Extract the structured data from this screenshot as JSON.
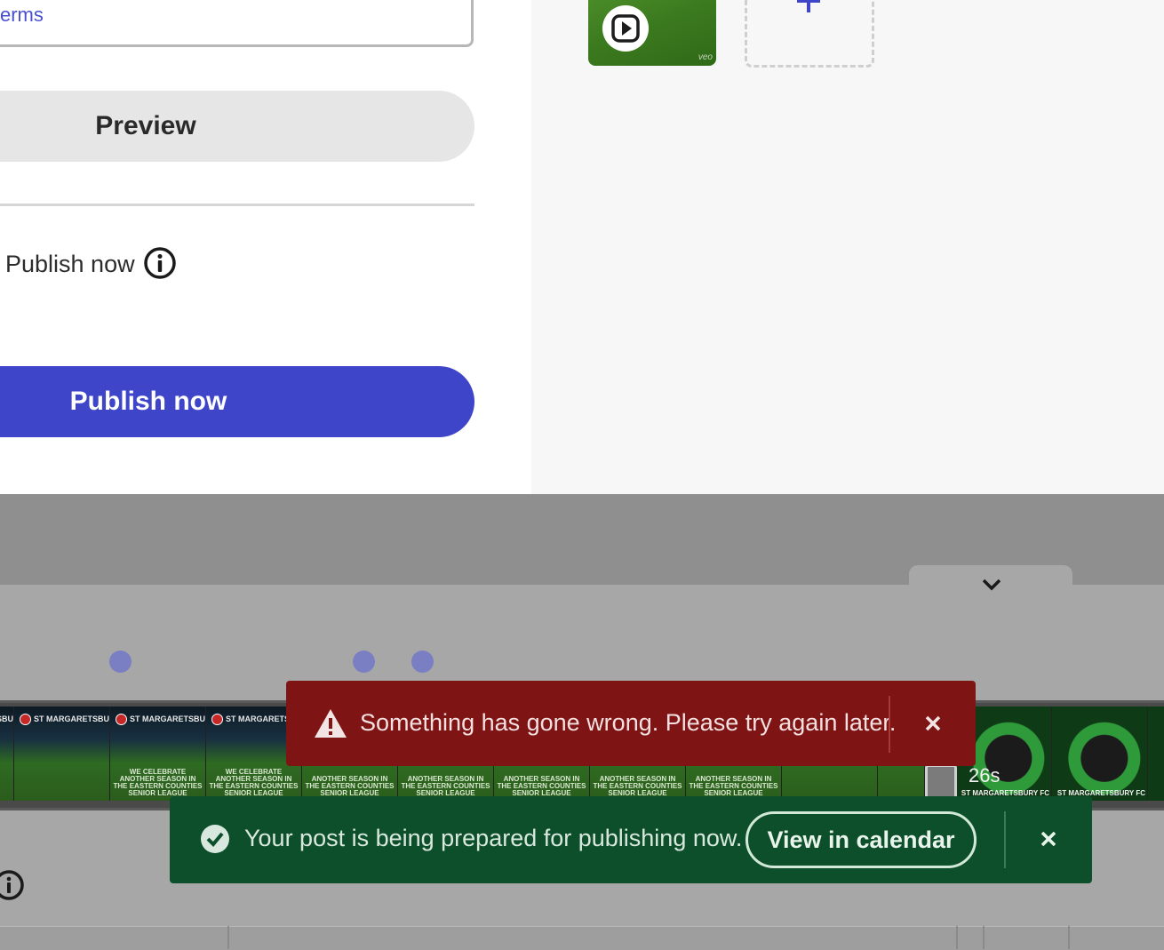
{
  "form": {
    "terms_link": "erms",
    "preview_label": "Preview",
    "publish_option_label": "Publish now",
    "publish_button_label": "Publish now"
  },
  "media": {
    "thumb_watermark": "veo",
    "icons": {
      "play": "play-icon",
      "add": "plus-icon"
    }
  },
  "timeline": {
    "duration": "26s",
    "frame_header": "ST MARGARETSBURY FC",
    "frame_header_short": "ST MARGARETSBURY",
    "frames": [
      {
        "caption": ""
      },
      {
        "caption": "WE CELEBRATE ANOTHER SEASON IN THE EASTERN COUNTIES SENIOR LEAGUE"
      },
      {
        "caption": "WE CELEBRATE ANOTHER SEASON IN THE EASTERN COUNTIES SENIOR LEAGUE"
      },
      {
        "caption": "ANOTHER SEASON IN THE EASTERN COUNTIES SENIOR LEAGUE"
      },
      {
        "caption": "ANOTHER SEASON IN THE EASTERN COUNTIES SENIOR LEAGUE"
      },
      {
        "caption": "ANOTHER SEASON IN THE EASTERN COUNTIES SENIOR LEAGUE"
      },
      {
        "caption": "ANOTHER SEASON IN THE EASTERN COUNTIES SENIOR LEAGUE"
      },
      {
        "caption": "ANOTHER SEASON IN THE EASTERN COUNTIES SENIOR LEAGUE"
      },
      {
        "caption": ""
      },
      {
        "caption": ""
      }
    ],
    "right_frames_caption": "ST MARGARETSBURY FC"
  },
  "toasts": {
    "error": {
      "message": "Something has gone wrong. Please try again later.",
      "color": "#7e1414"
    },
    "success": {
      "message": "Your post is being prepared for publishing now.",
      "action_label": "View in calendar",
      "color": "#0d4f2a"
    }
  },
  "colors": {
    "accent": "#3f45c9",
    "overlay": "#8f8f8f"
  }
}
